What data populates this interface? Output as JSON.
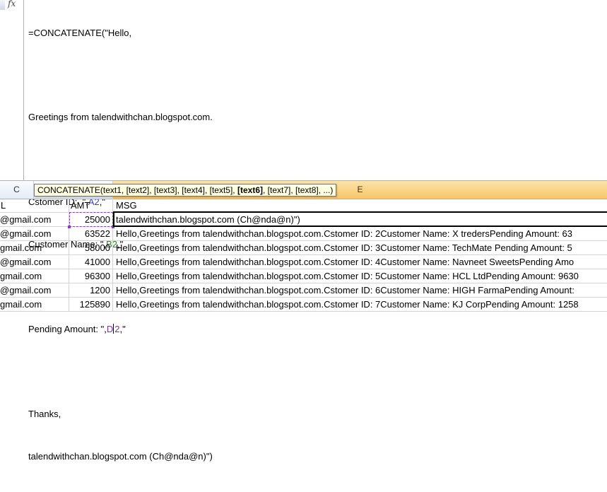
{
  "formula_bar": {
    "fx_label": "fx",
    "lines": [
      {
        "text": "=CONCATENATE(\"Hello,"
      },
      {
        "text": ""
      },
      {
        "text": "Greetings from talendwithchan.blogspot.com."
      },
      {
        "text": ""
      },
      {
        "pre": "Cstomer ID:  \",",
        "ref": "A2",
        "post": ",\""
      },
      {
        "pre": "Customer Name: \",",
        "ref": "B2",
        "post": ",\""
      },
      {
        "text": ""
      },
      {
        "pre": "Pending Amount: \",",
        "ref": "D2",
        "post": ",\""
      },
      {
        "text": ""
      },
      {
        "text": "Thanks,"
      },
      {
        "text": "talendwithchan.blogspot.com (Ch@nda@n)\")"
      }
    ],
    "ref_colors": {
      "A2": "#2f44b8",
      "B2": "#1c8a1c",
      "D2": "#7d2fb8"
    }
  },
  "column_headers": {
    "c": "C",
    "d": "",
    "e": "E"
  },
  "tooltip": {
    "prefix": "CONCATENATE(text1, [text2], [text3], [text4], [text5], ",
    "bold": "[text6]",
    "suffix": ", [text7], [text8], ...)"
  },
  "grid": {
    "header": {
      "email": "L",
      "amt": "AMT",
      "msg": "MSG"
    },
    "rows": [
      {
        "email": "@gmail.com",
        "amt": "25000",
        "msg": "talendwithchan.blogspot.com (Ch@nda@n)\")"
      },
      {
        "email": "@gmail.com",
        "amt": "63522",
        "msg": "Hello,Greetings from talendwithchan.blogspot.com.Cstomer ID:  2Customer Name: X tredersPending Amount: 63"
      },
      {
        "email": "gmail.com",
        "amt": "58000",
        "msg": "Hello,Greetings from talendwithchan.blogspot.com.Cstomer ID:  3Customer Name: TechMate Pending Amount: 5"
      },
      {
        "email": "@gmail.com",
        "amt": "41000",
        "msg": "Hello,Greetings from talendwithchan.blogspot.com.Cstomer ID:  4Customer Name: Navneet SweetsPending Amo"
      },
      {
        "email": "gmail.com",
        "amt": "96300",
        "msg": "Hello,Greetings from talendwithchan.blogspot.com.Cstomer ID:  5Customer Name: HCL LtdPending Amount: 9630"
      },
      {
        "email": "@gmail.com",
        "amt": "1200",
        "msg": "Hello,Greetings from talendwithchan.blogspot.com.Cstomer ID:  6Customer Name: HIGH FarmaPending Amount:"
      },
      {
        "email": "gmail.com",
        "amt": "125890",
        "msg": "Hello,Greetings from talendwithchan.blogspot.com.Cstomer ID:  7Customer Name: KJ CorpPending Amount: 1258"
      }
    ]
  }
}
